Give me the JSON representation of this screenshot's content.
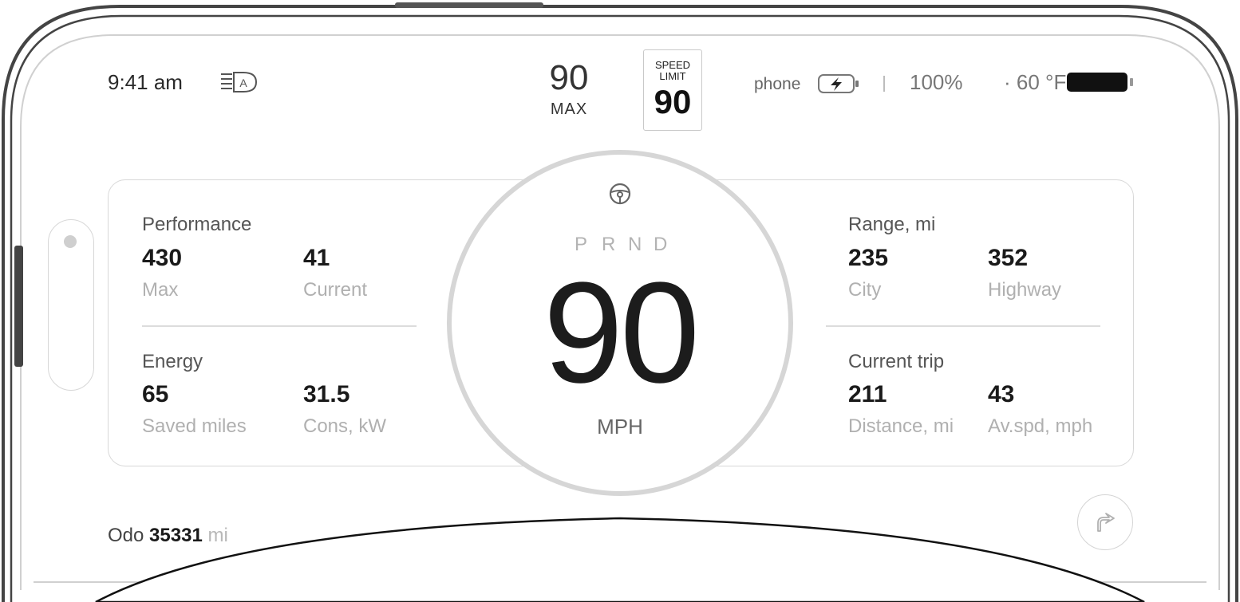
{
  "status_bar": {
    "time": "9:41 am",
    "headlight_icon": "auto-headlights-icon",
    "set_speed": {
      "value": "90",
      "label": "MAX"
    },
    "speed_limit": {
      "line1": "SPEED",
      "line2": "LIMIT",
      "value": "90"
    },
    "phone": {
      "label": "phone",
      "icon": "phone-charging-icon"
    },
    "battery_percent": "100%",
    "separator": "·",
    "temperature": "60 °F",
    "car_battery_icon": "battery-full-icon"
  },
  "left_panel": {
    "performance": {
      "title": "Performance",
      "stats": [
        {
          "value": "430",
          "label": "Max"
        },
        {
          "value": "41",
          "label": "Current"
        }
      ]
    },
    "energy": {
      "title": "Energy",
      "stats": [
        {
          "value": "65",
          "label": "Saved miles"
        },
        {
          "value": "31.5",
          "label": "Cons, kW"
        }
      ]
    }
  },
  "right_panel": {
    "range": {
      "title": "Range, mi",
      "stats": [
        {
          "value": "235",
          "label": "City"
        },
        {
          "value": "352",
          "label": "Highway"
        }
      ]
    },
    "current_trip": {
      "title": "Current trip",
      "stats": [
        {
          "value": "211",
          "label": "Distance, mi"
        },
        {
          "value": "43",
          "label": "Av.spd, mph"
        }
      ]
    }
  },
  "speedometer": {
    "gears": [
      "P",
      "R",
      "N",
      "D"
    ],
    "speed": "90",
    "unit": "MPH",
    "icon": "steering-wheel-icon"
  },
  "odometer": {
    "label": "Odo",
    "value": "35331",
    "unit": "mi"
  },
  "nav_button_icon": "navigation-arrow-icon",
  "colors": {
    "text": "#1e1e1e",
    "muted": "#b0b0b0",
    "border": "#d8d8d8"
  }
}
